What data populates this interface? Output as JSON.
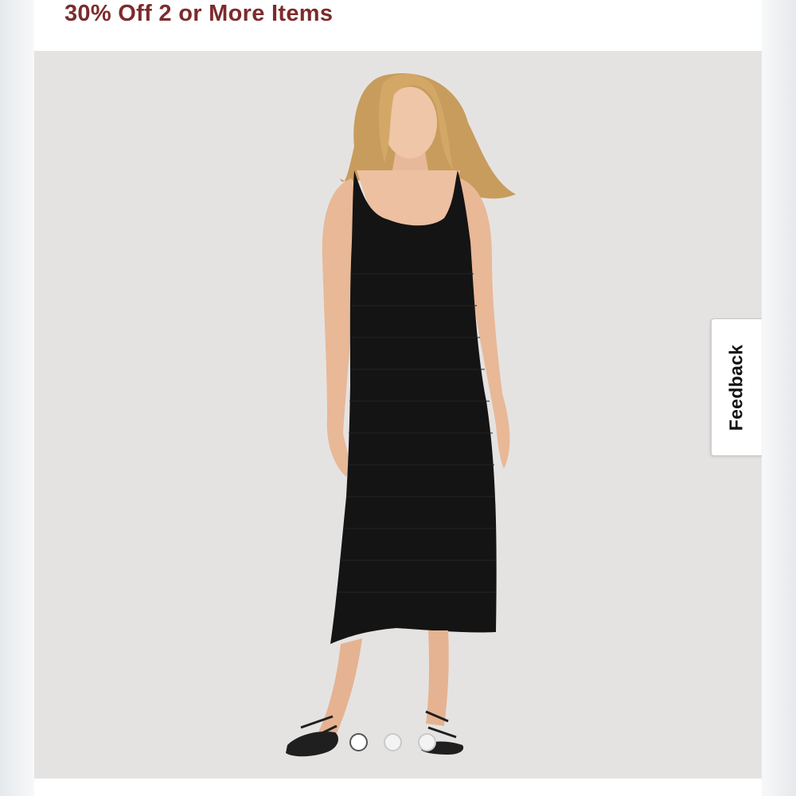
{
  "promo": {
    "text": "30% Off 2 or More Items",
    "color": "#7d2b2b"
  },
  "gallery": {
    "background_color": "#e5e3e2",
    "image_description_icon": "product-photo",
    "dots": [
      {
        "state": "active"
      },
      {
        "state": "inactive"
      },
      {
        "state": "inactive"
      }
    ]
  },
  "feedback": {
    "label": "Feedback"
  }
}
